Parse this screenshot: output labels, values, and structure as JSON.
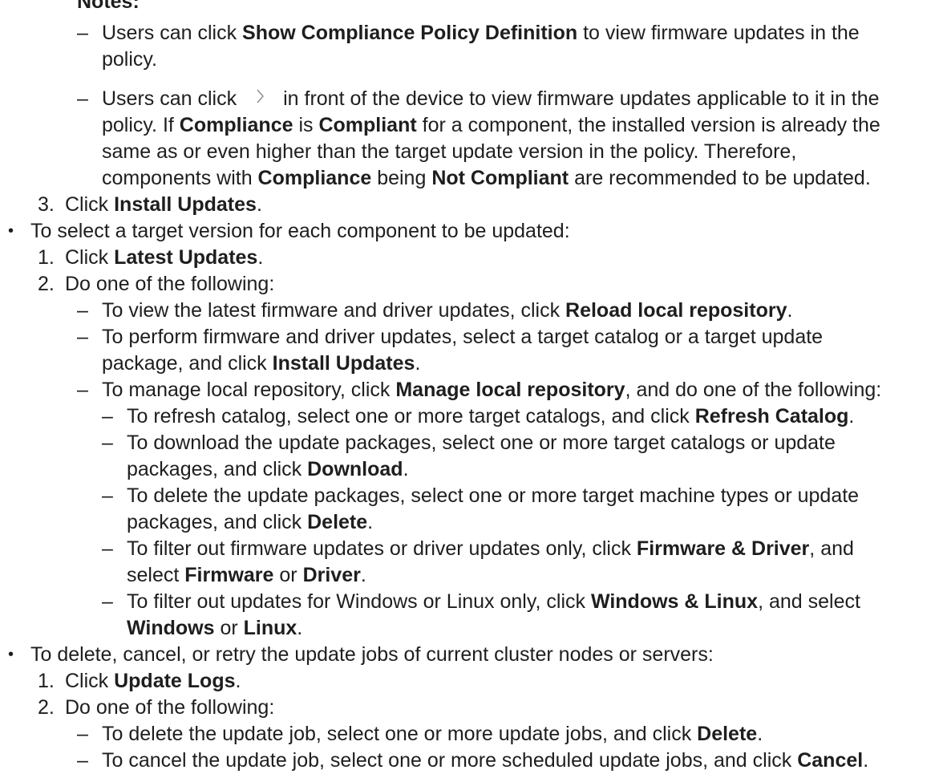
{
  "notes": {
    "heading": "Notes:",
    "note1": {
      "a": "Users can click ",
      "b1": "Show Compliance Policy Definition",
      "c": " to view firmware updates in the",
      "d": "policy."
    },
    "note2": {
      "a": "Users can click",
      "b": "in front of the device to view firmware updates applicable to it in the",
      "l2_a": "policy. If ",
      "l2_b1": "Compliance",
      "l2_c": " is ",
      "l2_b2": "Compliant",
      "l2_d": " for a component, the installed version is already the",
      "l3": "same as or even higher than the target update version in the policy. Therefore,",
      "l4_a": "components with ",
      "l4_b1": "Compliance",
      "l4_c": " being ",
      "l4_b2": "Not Compliant",
      "l4_d": " are recommended to be updated."
    }
  },
  "step3": {
    "num": "3.",
    "a": "Click ",
    "b": "Install Updates",
    "c": "."
  },
  "sec2": {
    "intro": "To select a target version for each component to be updated:",
    "s1": {
      "num": "1.",
      "a": "Click ",
      "b": "Latest Updates",
      "c": "."
    },
    "s2": {
      "num": "2.",
      "a": "Do one of the following:"
    },
    "d1": {
      "a": "To view the latest firmware and driver updates, click ",
      "b": "Reload local repository",
      "c": "."
    },
    "d2": {
      "a": "To perform firmware and driver updates, select a target catalog or a target update",
      "l2_a": "package, and click ",
      "l2_b": "Install Updates",
      "l2_c": "."
    },
    "d3": {
      "a": "To manage local repository, click ",
      "b": "Manage local repository",
      "c": ", and do one of the following:"
    },
    "e1": {
      "a": "To refresh catalog, select one or more target catalogs, and click ",
      "b": "Refresh Catalog",
      "c": "."
    },
    "e2": {
      "a": "To download the update packages, select one or more target catalogs or update",
      "l2_a": "packages, and click ",
      "l2_b": "Download",
      "l2_c": "."
    },
    "e3": {
      "a": "To delete the update packages, select one or more target machine types or update",
      "l2_a": "packages, and click ",
      "l2_b": "Delete",
      "l2_c": "."
    },
    "e4": {
      "a": "To filter out firmware updates or driver updates only, click ",
      "b": "Firmware & Driver",
      "c": ", and",
      "l2_a": "select ",
      "l2_b1": "Firmware",
      "l2_c": " or ",
      "l2_b2": "Driver",
      "l2_d": "."
    },
    "e5": {
      "a": "To filter out updates for Windows or Linux only, click ",
      "b": "Windows & Linux",
      "c": ", and select",
      "l2_b1": "Windows",
      "l2_c": " or ",
      "l2_b2": "Linux",
      "l2_d": "."
    }
  },
  "sec3": {
    "intro": "To delete, cancel, or retry the update jobs of current cluster nodes or servers:",
    "s1": {
      "num": "1.",
      "a": "Click ",
      "b": "Update Logs",
      "c": "."
    },
    "s2": {
      "num": "2.",
      "a": "Do one of the following:"
    },
    "d1": {
      "a": "To delete the update job, select one or more update jobs, and click ",
      "b": "Delete",
      "c": "."
    },
    "d2": {
      "a": "To cancel the update job, select one or more scheduled update jobs, and click ",
      "b": "Cancel",
      "c": "."
    }
  },
  "glyphs": {
    "dash": "–",
    "bullet": "•"
  }
}
